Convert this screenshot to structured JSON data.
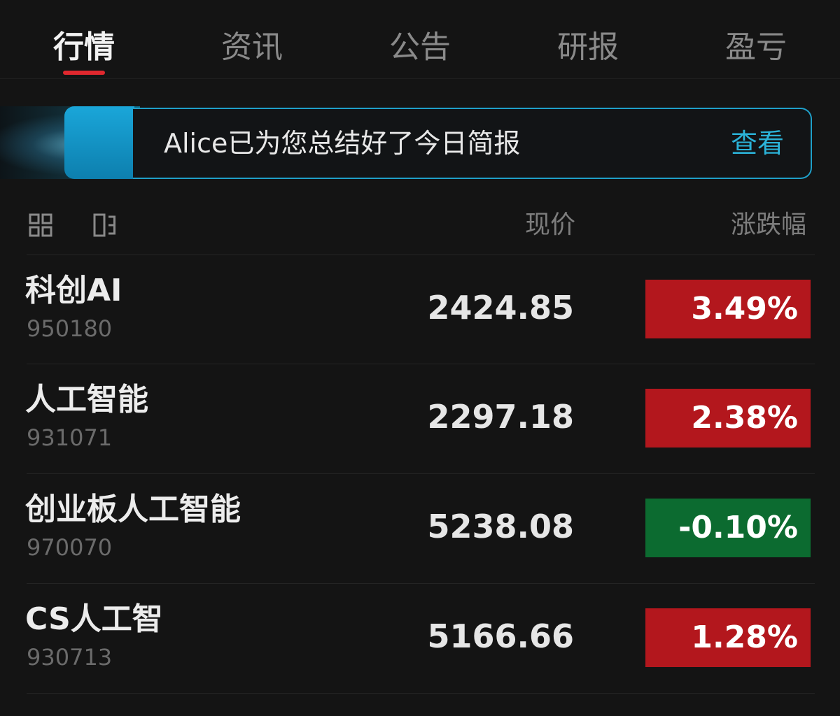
{
  "tabs": [
    {
      "label": "行情",
      "active": true
    },
    {
      "label": "资讯",
      "active": false
    },
    {
      "label": "公告",
      "active": false
    },
    {
      "label": "研报",
      "active": false
    },
    {
      "label": "盈亏",
      "active": false
    }
  ],
  "banner": {
    "text": "Alice已为您总结好了今日简报",
    "action": "查看"
  },
  "list_header": {
    "price_label": "现价",
    "change_label": "涨跌幅",
    "icons": [
      "grid-view-icon",
      "list-toggle-icon"
    ]
  },
  "rows": [
    {
      "name": "科创AI",
      "code": "950180",
      "price": "2424.85",
      "change": "3.49%",
      "direction": "up"
    },
    {
      "name": "人工智能",
      "code": "931071",
      "price": "2297.18",
      "change": "2.38%",
      "direction": "up"
    },
    {
      "name": "创业板人工智能",
      "code": "970070",
      "price": "5238.08",
      "change": "-0.10%",
      "direction": "down"
    },
    {
      "name": "CS人工智",
      "code": "930713",
      "price": "5166.66",
      "change": "1.28%",
      "direction": "up"
    }
  ],
  "colors": {
    "background": "#141414",
    "accent_red": "#e0282e",
    "up": "#b3171d",
    "down": "#0c6b30",
    "banner_border": "#1f9fc8",
    "banner_action": "#2bb3d8"
  }
}
